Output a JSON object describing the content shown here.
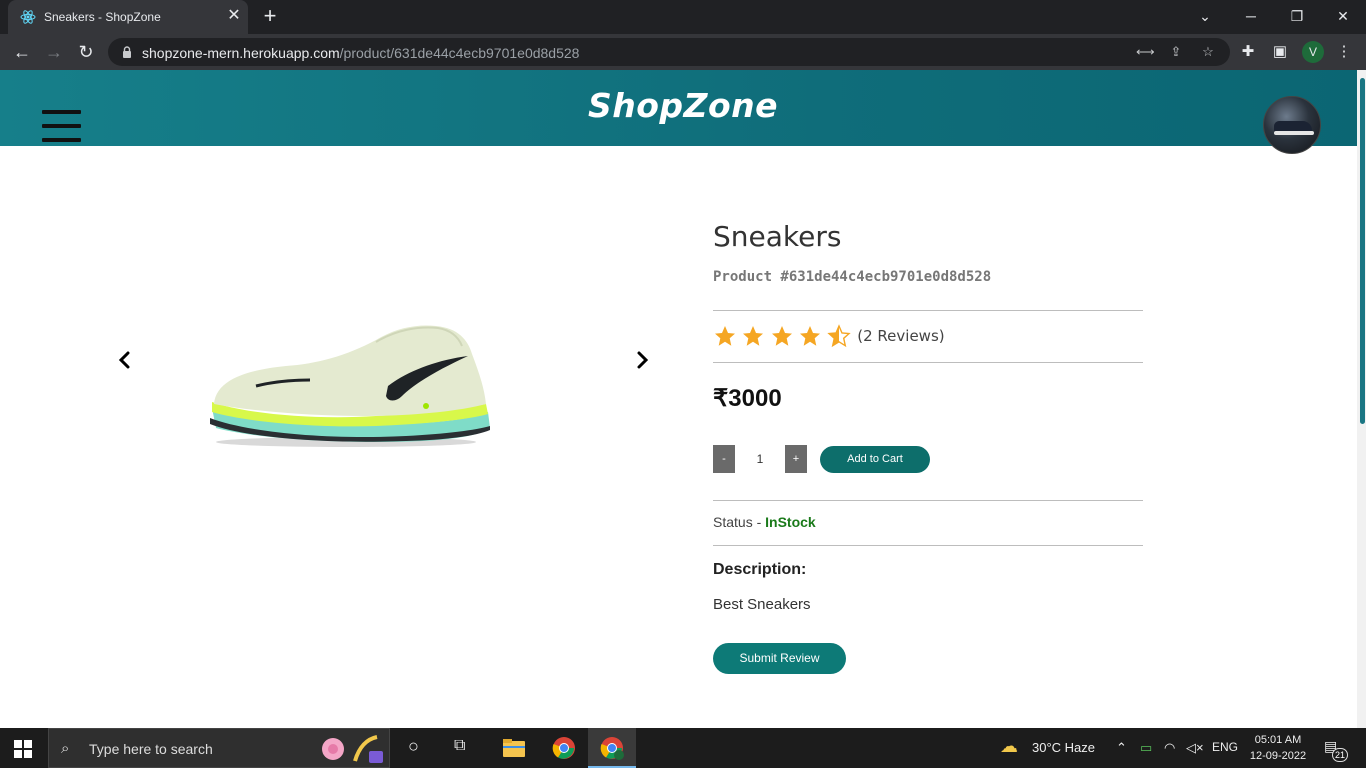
{
  "browser": {
    "tab_title": "Sneakers - ShopZone",
    "tab_close": "✕",
    "new_tab": "+",
    "url_host": "shopzone-mern.herokuapp.com",
    "url_path": "/product/631de44c4ecb9701e0d8d528",
    "profile_initial": "V"
  },
  "header": {
    "brand": "ShopZone"
  },
  "product": {
    "title": "Sneakers",
    "product_id": "Product #631de44c4ecb9701e0d8d528",
    "rating": 4.5,
    "rating_max": 5,
    "reviews_text": "(2 Reviews)",
    "price": "₹3000",
    "quantity": "1",
    "qty_minus": "-",
    "qty_plus": "+",
    "add_to_cart": "Add to Cart",
    "status_label": "Status - ",
    "status_value": "InStock",
    "description_heading": "Description:",
    "description_text": "Best Sneakers",
    "submit_review": "Submit Review"
  },
  "carousel": {
    "prev": "‹",
    "next": "›"
  },
  "taskbar": {
    "search_placeholder": "Type here to search",
    "weather": "30°C  Haze",
    "language": "ENG",
    "time": "05:01 AM",
    "date": "12-09-2022",
    "notification_count": "21"
  },
  "colors": {
    "header_teal": "#0f6d7a",
    "button_teal": "#0d6e6b",
    "star_gold": "#f5a623",
    "instock_green": "#1a7a1a"
  }
}
